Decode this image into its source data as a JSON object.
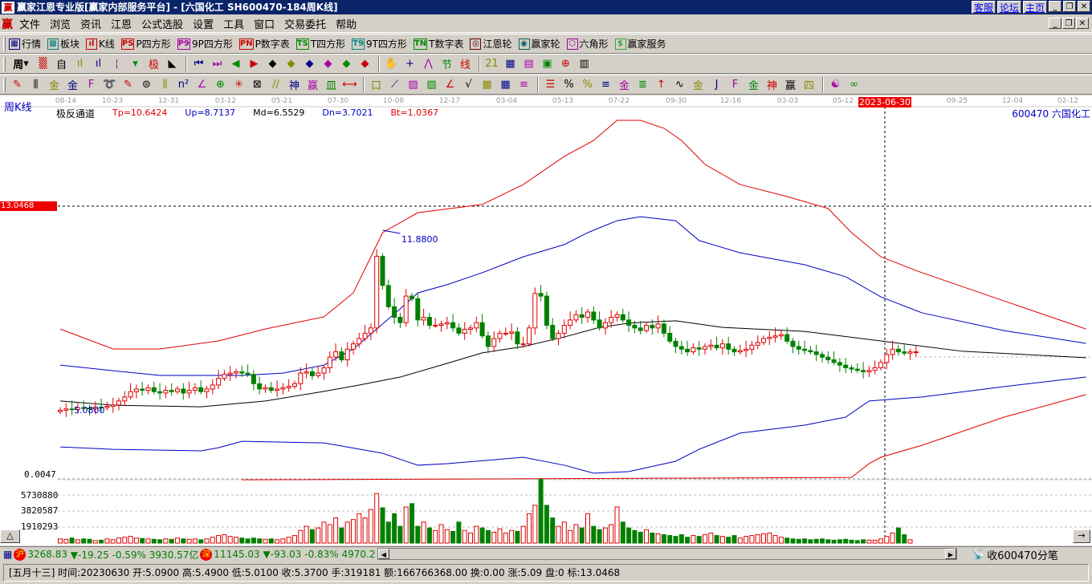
{
  "window": {
    "title": "赢家江恩专业版[赢家内部服务平台] - [六国化工   SH600470-184周K线]",
    "links": [
      "客服",
      "论坛",
      "主页"
    ]
  },
  "menu": [
    "文件",
    "浏览",
    "资讯",
    "江恩",
    "公式选股",
    "设置",
    "工具",
    "窗口",
    "交易委托",
    "帮助"
  ],
  "toolbar1": [
    {
      "icon": "table-icon",
      "glyph": "▦",
      "label": "行情",
      "color": "#000080"
    },
    {
      "icon": "blocks-icon",
      "glyph": "▩",
      "label": "板块",
      "color": "#008080"
    },
    {
      "icon": "kline-icon",
      "glyph": "ıl",
      "label": "K线",
      "color": "#c00"
    },
    {
      "icon": "ps-icon",
      "glyph": "PS",
      "label": "P四方形",
      "color": "#c00"
    },
    {
      "icon": "p9-icon",
      "glyph": "P9",
      "label": "9P四方形",
      "color": "#a0a"
    },
    {
      "icon": "pn-icon",
      "glyph": "PN",
      "label": "P数字表",
      "color": "#c00"
    },
    {
      "icon": "ts-icon",
      "glyph": "TS",
      "label": "T四方形",
      "color": "#080"
    },
    {
      "icon": "t9-icon",
      "glyph": "T9",
      "label": "9T四方形",
      "color": "#088"
    },
    {
      "icon": "tn-icon",
      "glyph": "TN",
      "label": "T数字表",
      "color": "#080"
    },
    {
      "icon": "gann-wheel-icon",
      "glyph": "◎",
      "label": "江恩轮",
      "color": "#600"
    },
    {
      "icon": "winner-wheel-icon",
      "glyph": "◉",
      "label": "赢家轮",
      "color": "#066"
    },
    {
      "icon": "hexagon-icon",
      "glyph": "⬡",
      "label": "六角形",
      "color": "#a0a"
    },
    {
      "icon": "dollar-icon",
      "glyph": "$",
      "label": "赢家服务",
      "color": "#3a3"
    }
  ],
  "toolbar2": {
    "period": "周",
    "icons": [
      {
        "icon": "grid-icon",
        "glyph": "▒"
      },
      {
        "icon": "auto-icon",
        "glyph": "自"
      },
      {
        "icon": "bars3-icon",
        "glyph": "ıl"
      },
      {
        "icon": "bars9-icon",
        "glyph": "ıl"
      },
      {
        "icon": "candle-icon",
        "glyph": "¦"
      },
      {
        "icon": "dropdown-icon",
        "glyph": "▾"
      },
      {
        "icon": "extreme-icon",
        "glyph": "极"
      },
      {
        "icon": "flag-icon",
        "glyph": "◣"
      },
      {
        "sep": true
      },
      {
        "icon": "first-icon",
        "glyph": "⏮"
      },
      {
        "icon": "last-icon",
        "glyph": "⏭"
      },
      {
        "icon": "left-icon",
        "glyph": "◀"
      },
      {
        "icon": "right-icon",
        "glyph": "▶"
      },
      {
        "icon": "diamond-left-icon",
        "glyph": "◆"
      },
      {
        "icon": "diamond-right-icon",
        "glyph": "◆"
      },
      {
        "icon": "diamond-expand-icon",
        "glyph": "◆"
      },
      {
        "icon": "diamond-shrink-icon",
        "glyph": "◆"
      },
      {
        "icon": "diamond-cross-icon",
        "glyph": "◆"
      },
      {
        "icon": "diamond-updown-icon",
        "glyph": "◆"
      },
      {
        "sep": true
      },
      {
        "icon": "hand-icon",
        "glyph": "✋"
      },
      {
        "icon": "crosshair-icon",
        "glyph": "+"
      },
      {
        "icon": "zigzag-icon",
        "glyph": "⋀"
      },
      {
        "icon": "section-icon",
        "glyph": "节"
      },
      {
        "icon": "line-icon",
        "glyph": "线"
      },
      {
        "sep": true
      },
      {
        "icon": "calendar-icon",
        "glyph": "21"
      },
      {
        "icon": "calculator-icon",
        "glyph": "▦"
      },
      {
        "icon": "notes-icon",
        "glyph": "▤"
      },
      {
        "icon": "save-icon",
        "glyph": "▣"
      },
      {
        "icon": "network-icon",
        "glyph": "⊕"
      },
      {
        "icon": "trade-icon",
        "glyph": "▥"
      }
    ]
  },
  "toolbar3": {
    "icons": [
      {
        "icon": "pen-icon",
        "glyph": "✎"
      },
      {
        "icon": "parallel-icon",
        "glyph": "⫼"
      },
      {
        "icon": "gold1-icon",
        "glyph": "金"
      },
      {
        "icon": "gold2-icon",
        "glyph": "金"
      },
      {
        "icon": "fib-icon",
        "glyph": "F"
      },
      {
        "icon": "spiral-icon",
        "glyph": "➰"
      },
      {
        "icon": "pen2-icon",
        "glyph": "✎"
      },
      {
        "icon": "circle-grid-icon",
        "glyph": "⊜"
      },
      {
        "icon": "lines-icon",
        "glyph": "⫼"
      },
      {
        "icon": "n2-icon",
        "glyph": "n²"
      },
      {
        "icon": "angle-icon",
        "glyph": "∠"
      },
      {
        "icon": "target-icon",
        "glyph": "⊕"
      },
      {
        "icon": "star-icon",
        "glyph": "✳"
      },
      {
        "icon": "square-icon",
        "glyph": "⊠"
      },
      {
        "icon": "slash-icon",
        "glyph": "//"
      },
      {
        "icon": "shen-icon",
        "glyph": "神"
      },
      {
        "icon": "ying-icon",
        "glyph": "赢"
      },
      {
        "icon": "comb-icon",
        "glyph": "皿"
      },
      {
        "icon": "range-icon",
        "glyph": "⟷"
      },
      {
        "sep": true
      },
      {
        "icon": "box-icon",
        "glyph": "口"
      },
      {
        "icon": "fan-icon",
        "glyph": "⟋"
      },
      {
        "icon": "fan-box-icon",
        "glyph": "▨"
      },
      {
        "icon": "fan-box2-icon",
        "glyph": "▧"
      },
      {
        "icon": "fan-lines-icon",
        "glyph": "∠"
      },
      {
        "icon": "v-icon",
        "glyph": "√"
      },
      {
        "icon": "grid2-icon",
        "glyph": "▦"
      },
      {
        "icon": "grid3-icon",
        "glyph": "▦"
      },
      {
        "icon": "triple-slash-icon",
        "glyph": "≡"
      },
      {
        "sep": true
      },
      {
        "icon": "list-icon",
        "glyph": "☰"
      },
      {
        "icon": "pct-line-icon",
        "glyph": "%"
      },
      {
        "icon": "percent-icon",
        "glyph": "%"
      },
      {
        "icon": "pct-lines-icon",
        "glyph": "≡"
      },
      {
        "icon": "gold-circle-icon",
        "glyph": "金"
      },
      {
        "icon": "gold-lines-icon",
        "glyph": "≣"
      },
      {
        "icon": "arrow-lines-icon",
        "glyph": "↑"
      },
      {
        "icon": "wave-icon",
        "glyph": "∿"
      },
      {
        "icon": "gold-box-icon",
        "glyph": "金"
      },
      {
        "icon": "j-fan-icon",
        "glyph": "J"
      },
      {
        "icon": "f-fan-icon",
        "glyph": "F"
      },
      {
        "icon": "gold-fan-icon",
        "glyph": "金"
      },
      {
        "icon": "shen-fan-icon",
        "glyph": "神"
      },
      {
        "icon": "ying-fan-icon",
        "glyph": "赢"
      },
      {
        "icon": "four-fan-icon",
        "glyph": "四"
      },
      {
        "sep": true
      },
      {
        "icon": "yinyang-icon",
        "glyph": "☯"
      },
      {
        "icon": "infinity-icon",
        "glyph": "∞"
      }
    ]
  },
  "chart": {
    "period_label": "周K线",
    "indicator_name": "极反通道",
    "params": [
      {
        "text": "Tp=10.6424",
        "color": "#e00000"
      },
      {
        "text": "Up=8.7137",
        "color": "#0000c0"
      },
      {
        "text": "Md=6.5529",
        "color": "#000000"
      },
      {
        "text": "Dn=3.7021",
        "color": "#0000c0"
      },
      {
        "text": "Bt=1.0367",
        "color": "#e00000"
      }
    ],
    "stock_label": "600470 六国化工",
    "marker_value": "13.0468",
    "high_label": "11.8800",
    "low_label": "5.0800",
    "indicator_axis": "0.0047",
    "volume_ticks": [
      "5730880",
      "3820587",
      "1910293"
    ],
    "dates": [
      "08-14",
      "10-23",
      "12-31",
      "03-12",
      "05-21",
      "07-30",
      "10-08",
      "12-17",
      "03-04",
      "05-13",
      "07-22",
      "09-30",
      "12-16",
      "03-03",
      "05-12",
      "2023-06-30",
      "09-25",
      "12-04",
      "02-12"
    ],
    "highlight_date": "2023-06-30"
  },
  "chart_data": {
    "type": "candlestick",
    "title": "SH600470-184周K线",
    "marker_price": 13.0468,
    "crosshair_index": 140,
    "closes": [
      5.1,
      5.15,
      5.12,
      5.2,
      5.18,
      5.15,
      5.22,
      5.2,
      5.25,
      5.3,
      5.45,
      5.6,
      5.8,
      5.9,
      5.85,
      5.95,
      5.8,
      5.75,
      5.85,
      5.8,
      5.9,
      5.75,
      5.85,
      5.95,
      5.8,
      5.9,
      6.05,
      6.3,
      6.45,
      6.5,
      6.55,
      6.5,
      6.45,
      6.1,
      5.9,
      5.95,
      5.85,
      5.9,
      5.95,
      6.0,
      6.1,
      6.5,
      6.55,
      6.4,
      6.5,
      6.7,
      7.1,
      7.3,
      7.0,
      7.4,
      7.6,
      7.8,
      8.0,
      8.2,
      10.9,
      9.8,
      9.0,
      8.6,
      8.4,
      9.4,
      9.3,
      8.5,
      8.6,
      8.3,
      8.3,
      8.35,
      8.4,
      8.2,
      8.0,
      8.15,
      8.2,
      8.4,
      7.9,
      7.5,
      7.8,
      8.0,
      8.0,
      8.05,
      7.6,
      7.6,
      8.2,
      9.5,
      9.4,
      8.3,
      7.8,
      8.0,
      8.3,
      8.5,
      8.7,
      8.6,
      8.8,
      8.5,
      8.2,
      8.4,
      8.6,
      8.7,
      8.5,
      8.3,
      8.2,
      8.1,
      8.3,
      8.2,
      8.35,
      8.0,
      7.7,
      7.5,
      7.4,
      7.3,
      7.45,
      7.4,
      7.5,
      7.55,
      7.45,
      7.6,
      7.4,
      7.3,
      7.35,
      7.4,
      7.55,
      7.65,
      7.8,
      7.85,
      7.9,
      7.95,
      7.7,
      7.5,
      7.4,
      7.35,
      7.3,
      7.2,
      7.1,
      7.0,
      6.9,
      6.8,
      6.7,
      6.65,
      6.6,
      6.55,
      6.6,
      6.7,
      6.9,
      7.2,
      7.4,
      7.3,
      7.25,
      7.3,
      7.3
    ],
    "volumes": [
      500000,
      450000,
      600000,
      400000,
      500000,
      450000,
      300000,
      350000,
      500000,
      400000,
      600000,
      700000,
      800000,
      600000,
      550000,
      500000,
      450000,
      400000,
      500000,
      450000,
      600000,
      500000,
      450000,
      500000,
      400000,
      500000,
      700000,
      900000,
      1000000,
      800000,
      700000,
      600000,
      500000,
      600000,
      500000,
      450000,
      500000,
      400000,
      500000,
      700000,
      900000,
      1500000,
      2000000,
      1600000,
      1800000,
      2500000,
      2200000,
      3000000,
      1800000,
      2500000,
      2800000,
      3500000,
      3000000,
      4000000,
      5900000,
      4200000,
      2500000,
      3500000,
      2000000,
      4300000,
      4700000,
      2000000,
      2500000,
      1800000,
      1500000,
      2200000,
      1600000,
      1400000,
      2500000,
      1500000,
      1200000,
      2000000,
      1800000,
      1500000,
      1300000,
      1700000,
      1200000,
      1500000,
      1400000,
      2000000,
      3500000,
      4500000,
      7600000,
      4500000,
      3000000,
      2000000,
      2500000,
      1500000,
      2200000,
      1800000,
      3500000,
      2000000,
      1600000,
      1800000,
      2200000,
      4300000,
      2500000,
      1800000,
      1500000,
      1300000,
      1600000,
      1200000,
      1100000,
      1000000,
      900000,
      800000,
      1000000,
      700000,
      900000,
      800000,
      1000000,
      1200000,
      900000,
      800000,
      700000,
      900000,
      600000,
      800000,
      900000,
      1000000,
      1100000,
      1200000,
      900000,
      700000,
      600000,
      500000,
      450000,
      500000,
      400000,
      450000,
      500000,
      400000,
      350000,
      400000,
      450000,
      350000,
      300000,
      400000,
      350000,
      350000,
      500000,
      800000,
      1200000,
      1800000,
      1000000,
      400000
    ],
    "bands": [
      {
        "name": "Tp",
        "color": "#e00000",
        "points": [
          [
            0,
            8.16
          ],
          [
            9,
            7.41
          ],
          [
            17,
            7.41
          ],
          [
            27,
            7.71
          ],
          [
            35,
            8.16
          ],
          [
            45,
            8.62
          ],
          [
            50,
            9.52
          ],
          [
            53,
            10.88
          ],
          [
            55,
            11.79
          ],
          [
            61,
            12.54
          ],
          [
            72,
            12.85
          ],
          [
            79,
            13.6
          ],
          [
            86,
            14.66
          ],
          [
            91,
            15.26
          ],
          [
            95,
            16.02
          ],
          [
            99,
            16.02
          ],
          [
            103,
            15.72
          ],
          [
            106,
            15.26
          ],
          [
            110,
            14.36
          ],
          [
            116,
            13.6
          ],
          [
            124,
            13.15
          ],
          [
            131,
            12.7
          ],
          [
            135,
            11.79
          ],
          [
            140,
            10.88
          ],
          [
            147,
            10.28
          ],
          [
            161,
            9.22
          ],
          [
            175,
            8.16
          ]
        ]
      },
      {
        "name": "Up",
        "color": "#0000c0",
        "points": [
          [
            0,
            6.8
          ],
          [
            9,
            6.59
          ],
          [
            17,
            6.41
          ],
          [
            31,
            6.41
          ],
          [
            38,
            6.5
          ],
          [
            45,
            6.8
          ],
          [
            50,
            7.41
          ],
          [
            54,
            8.16
          ],
          [
            58,
            8.92
          ],
          [
            61,
            9.52
          ],
          [
            66,
            9.83
          ],
          [
            72,
            10.28
          ],
          [
            79,
            10.88
          ],
          [
            86,
            11.34
          ],
          [
            90,
            11.79
          ],
          [
            95,
            12.24
          ],
          [
            99,
            12.39
          ],
          [
            105,
            12.24
          ],
          [
            109,
            11.49
          ],
          [
            116,
            11.03
          ],
          [
            127,
            10.58
          ],
          [
            134,
            10.13
          ],
          [
            140,
            9.37
          ],
          [
            147,
            8.77
          ],
          [
            161,
            8.1
          ],
          [
            175,
            7.62
          ]
        ]
      },
      {
        "name": "Md",
        "color": "#000000",
        "points": [
          [
            0,
            5.45
          ],
          [
            9,
            5.29
          ],
          [
            24,
            5.23
          ],
          [
            35,
            5.45
          ],
          [
            45,
            5.81
          ],
          [
            51,
            6.05
          ],
          [
            58,
            6.35
          ],
          [
            65,
            6.8
          ],
          [
            72,
            7.26
          ],
          [
            79,
            7.5
          ],
          [
            86,
            7.86
          ],
          [
            92,
            8.22
          ],
          [
            97,
            8.38
          ],
          [
            99,
            8.41
          ],
          [
            105,
            8.47
          ],
          [
            113,
            8.22
          ],
          [
            127,
            8.07
          ],
          [
            140,
            7.71
          ],
          [
            154,
            7.32
          ],
          [
            175,
            7.08
          ]
        ]
      },
      {
        "name": "Dn",
        "color": "#0000c0",
        "points": [
          [
            0,
            3.72
          ],
          [
            9,
            3.63
          ],
          [
            24,
            3.57
          ],
          [
            27,
            3.69
          ],
          [
            31,
            3.93
          ],
          [
            45,
            3.87
          ],
          [
            55,
            3.48
          ],
          [
            61,
            3.03
          ],
          [
            66,
            3.09
          ],
          [
            79,
            3.33
          ],
          [
            86,
            3.03
          ],
          [
            91,
            2.73
          ],
          [
            97,
            2.79
          ],
          [
            105,
            3.18
          ],
          [
            109,
            3.63
          ],
          [
            116,
            4.24
          ],
          [
            127,
            4.54
          ],
          [
            134,
            4.84
          ],
          [
            138,
            5.45
          ],
          [
            147,
            5.6
          ],
          [
            161,
            5.99
          ],
          [
            175,
            6.35
          ]
        ]
      },
      {
        "name": "Bt",
        "color": "#e00000",
        "points": [
          [
            31,
            2.48
          ],
          [
            135,
            2.57
          ],
          [
            138,
            3.09
          ],
          [
            140,
            3.33
          ],
          [
            147,
            3.78
          ],
          [
            161,
            4.84
          ],
          [
            175,
            5.69
          ]
        ]
      }
    ]
  },
  "index_bar": {
    "sh_badge": "沪",
    "sh_value": "3268.83",
    "sh_change": "▼-19.25 -0.59% 3930.57亿",
    "sz_badge": "深",
    "sz_value": "11145.03",
    "sz_change": "▼-93.03 -0.83% 4970.2",
    "ticker": "收600470分笔"
  },
  "status": {
    "text": "[五月十三] 时间:20230630 开:5.0900 高:5.4900 低:5.0100 收:5.3700 手:319181 额:166766368.00 换:0.00 涨:5.09 盘:0 标:13.0468"
  }
}
